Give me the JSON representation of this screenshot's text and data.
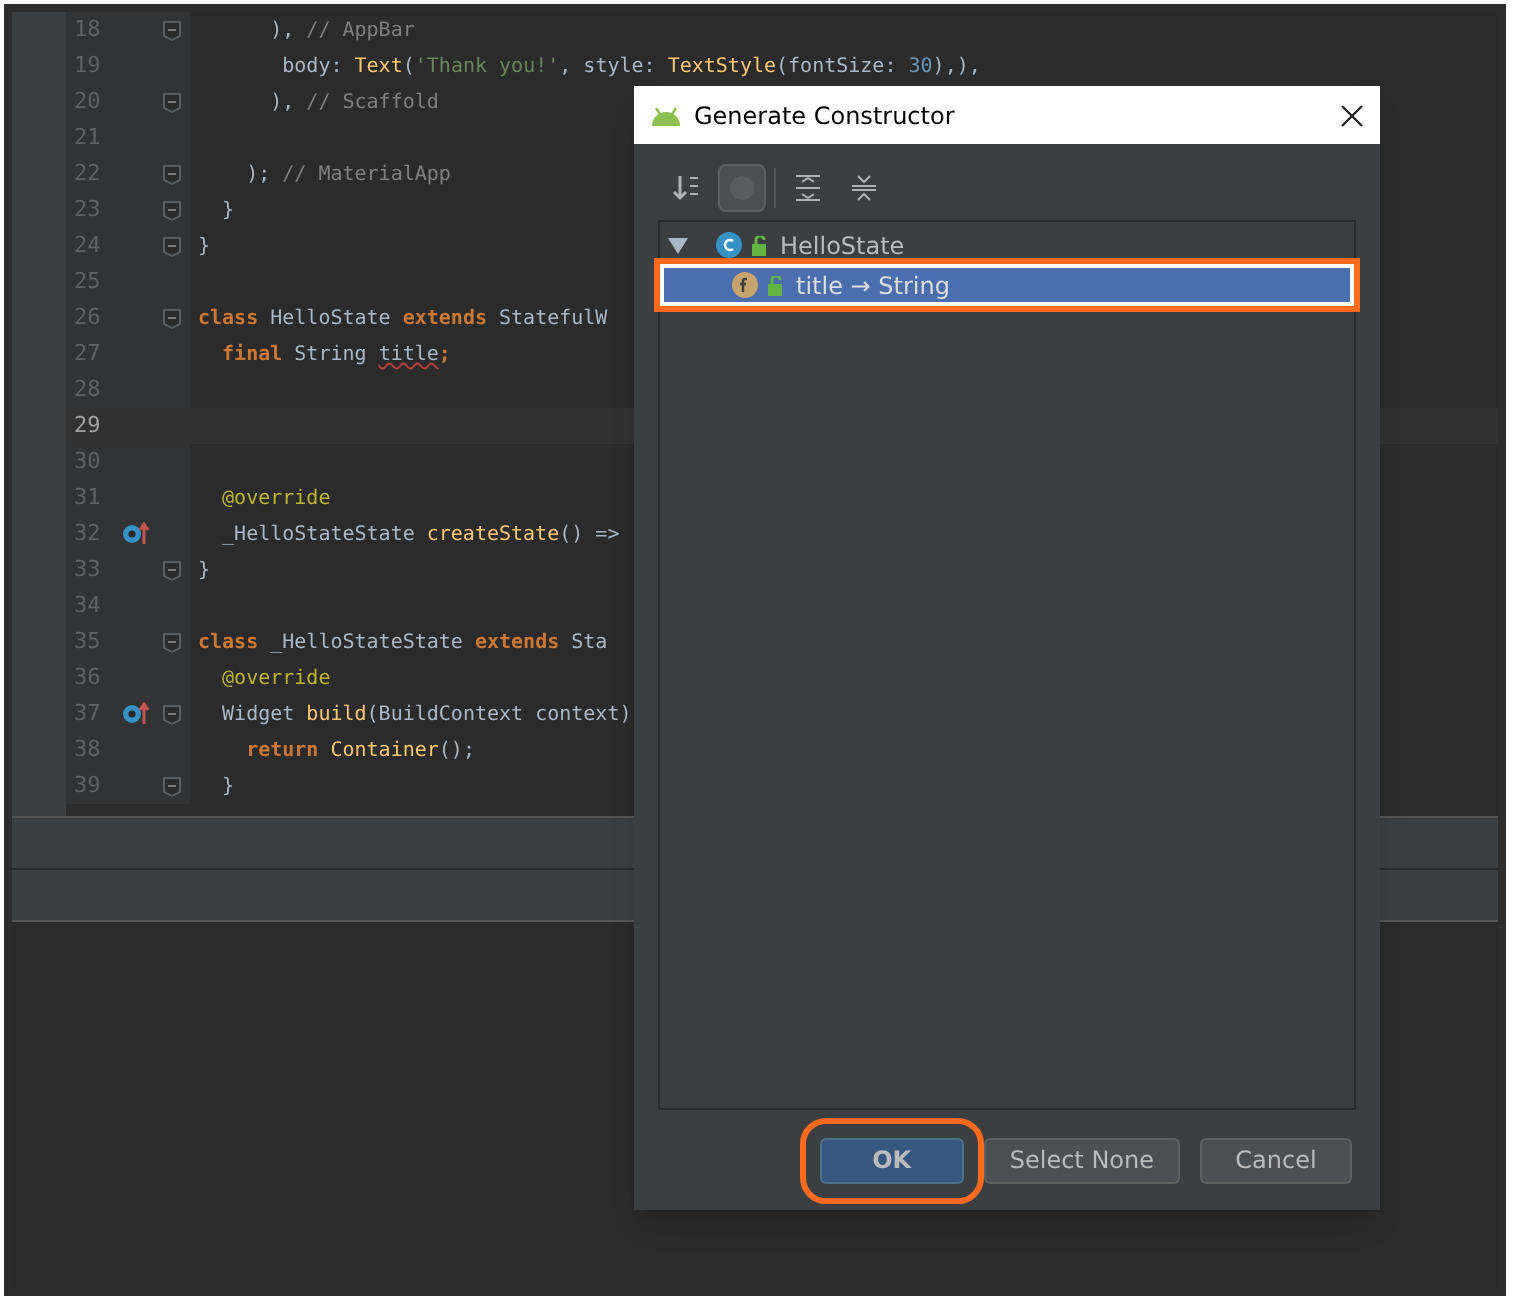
{
  "editor": {
    "lines": [
      {
        "number": "18",
        "fold": true,
        "gutter_icon": false,
        "current": false,
        "segments": [
          {
            "t": "      ), ",
            "kind": "plain"
          },
          {
            "t": "// AppBar",
            "kind": "comment"
          }
        ]
      },
      {
        "number": "19",
        "fold": false,
        "gutter_icon": false,
        "current": false,
        "segments": [
          {
            "t": "       body: ",
            "kind": "plain"
          },
          {
            "t": "Text",
            "kind": "func"
          },
          {
            "t": "(",
            "kind": "plain"
          },
          {
            "t": "'Thank you!'",
            "kind": "string"
          },
          {
            "t": ", style: ",
            "kind": "plain"
          },
          {
            "t": "TextStyle",
            "kind": "func"
          },
          {
            "t": "(fontSize: ",
            "kind": "plain"
          },
          {
            "t": "30",
            "kind": "number"
          },
          {
            "t": "),),",
            "kind": "plain"
          }
        ]
      },
      {
        "number": "20",
        "fold": true,
        "gutter_icon": false,
        "current": false,
        "segments": [
          {
            "t": "      ), ",
            "kind": "plain"
          },
          {
            "t": "// Scaffold",
            "kind": "comment"
          }
        ]
      },
      {
        "number": "21",
        "fold": false,
        "gutter_icon": false,
        "current": false
      },
      {
        "number": "22",
        "fold": true,
        "gutter_icon": false,
        "current": false,
        "segments": [
          {
            "t": "    ); ",
            "kind": "plain"
          },
          {
            "t": "// MaterialApp",
            "kind": "comment"
          }
        ]
      },
      {
        "number": "23",
        "fold": true,
        "gutter_icon": false,
        "current": false,
        "segments": [
          {
            "t": "  }",
            "kind": "plain"
          }
        ]
      },
      {
        "number": "24",
        "fold": true,
        "gutter_icon": false,
        "current": false,
        "segments": [
          {
            "t": "}",
            "kind": "plain"
          }
        ]
      },
      {
        "number": "25",
        "fold": false,
        "gutter_icon": false,
        "current": false
      },
      {
        "number": "26",
        "fold": true,
        "gutter_icon": false,
        "current": false,
        "segments": [
          {
            "t": "class ",
            "kind": "keyword"
          },
          {
            "t": "HelloState ",
            "kind": "plain"
          },
          {
            "t": "extends ",
            "kind": "keyword"
          },
          {
            "t": "StatefulW",
            "kind": "plain"
          }
        ]
      },
      {
        "number": "27",
        "fold": false,
        "gutter_icon": false,
        "current": false,
        "segments": [
          {
            "t": "  final ",
            "kind": "keyword"
          },
          {
            "t": "String ",
            "kind": "plain"
          },
          {
            "t": "title",
            "kind": "error"
          },
          {
            "t": ";",
            "kind": "keyword"
          }
        ]
      },
      {
        "number": "28",
        "fold": false,
        "gutter_icon": false,
        "current": false
      },
      {
        "number": "29",
        "fold": false,
        "gutter_icon": false,
        "current": true
      },
      {
        "number": "30",
        "fold": false,
        "gutter_icon": false,
        "current": false
      },
      {
        "number": "31",
        "fold": false,
        "gutter_icon": false,
        "current": false,
        "segments": [
          {
            "t": "  @override",
            "kind": "annotation"
          }
        ]
      },
      {
        "number": "32",
        "fold": false,
        "gutter_icon": true,
        "current": false,
        "segments": [
          {
            "t": "  _HelloStateState ",
            "kind": "plain"
          },
          {
            "t": "createState",
            "kind": "func"
          },
          {
            "t": "() =>",
            "kind": "plain"
          }
        ]
      },
      {
        "number": "33",
        "fold": true,
        "gutter_icon": false,
        "current": false,
        "segments": [
          {
            "t": "}",
            "kind": "plain"
          }
        ]
      },
      {
        "number": "34",
        "fold": false,
        "gutter_icon": false,
        "current": false
      },
      {
        "number": "35",
        "fold": true,
        "gutter_icon": false,
        "current": false,
        "segments": [
          {
            "t": "class ",
            "kind": "keyword"
          },
          {
            "t": "_HelloStateState ",
            "kind": "plain"
          },
          {
            "t": "extends ",
            "kind": "keyword"
          },
          {
            "t": "Sta",
            "kind": "plain"
          }
        ]
      },
      {
        "number": "36",
        "fold": false,
        "gutter_icon": false,
        "current": false,
        "segments": [
          {
            "t": "  @override",
            "kind": "annotation"
          }
        ]
      },
      {
        "number": "37",
        "fold": true,
        "gutter_icon": true,
        "current": false,
        "segments": [
          {
            "t": "  Widget ",
            "kind": "plain"
          },
          {
            "t": "build",
            "kind": "func"
          },
          {
            "t": "(BuildContext context)",
            "kind": "plain"
          }
        ]
      },
      {
        "number": "38",
        "fold": false,
        "gutter_icon": false,
        "current": false,
        "segments": [
          {
            "t": "    return ",
            "kind": "keyword"
          },
          {
            "t": "Container",
            "kind": "func"
          },
          {
            "t": "();",
            "kind": "plain"
          }
        ]
      },
      {
        "number": "39",
        "fold": true,
        "gutter_icon": false,
        "current": false,
        "segments": [
          {
            "t": "  }",
            "kind": "plain"
          }
        ]
      }
    ]
  },
  "dialog": {
    "title": "Generate Constructor",
    "toolbar": [
      {
        "kind": "sort",
        "pressed": false
      },
      {
        "kind": "toggle",
        "pressed": true
      },
      {
        "kind": "expand",
        "pressed": false
      },
      {
        "kind": "collapse",
        "pressed": false
      }
    ],
    "tree": [
      {
        "label": "HelloState",
        "expanded": true,
        "selected": false,
        "children": [
          {
            "label": "title → String",
            "selected": true,
            "highlighted": true
          }
        ]
      }
    ],
    "buttons": [
      {
        "label": "OK",
        "default": true,
        "highlighted": true
      },
      {
        "label": "Select None",
        "default": false,
        "highlighted": false
      },
      {
        "label": "Cancel",
        "default": false,
        "highlighted": false
      }
    ]
  }
}
